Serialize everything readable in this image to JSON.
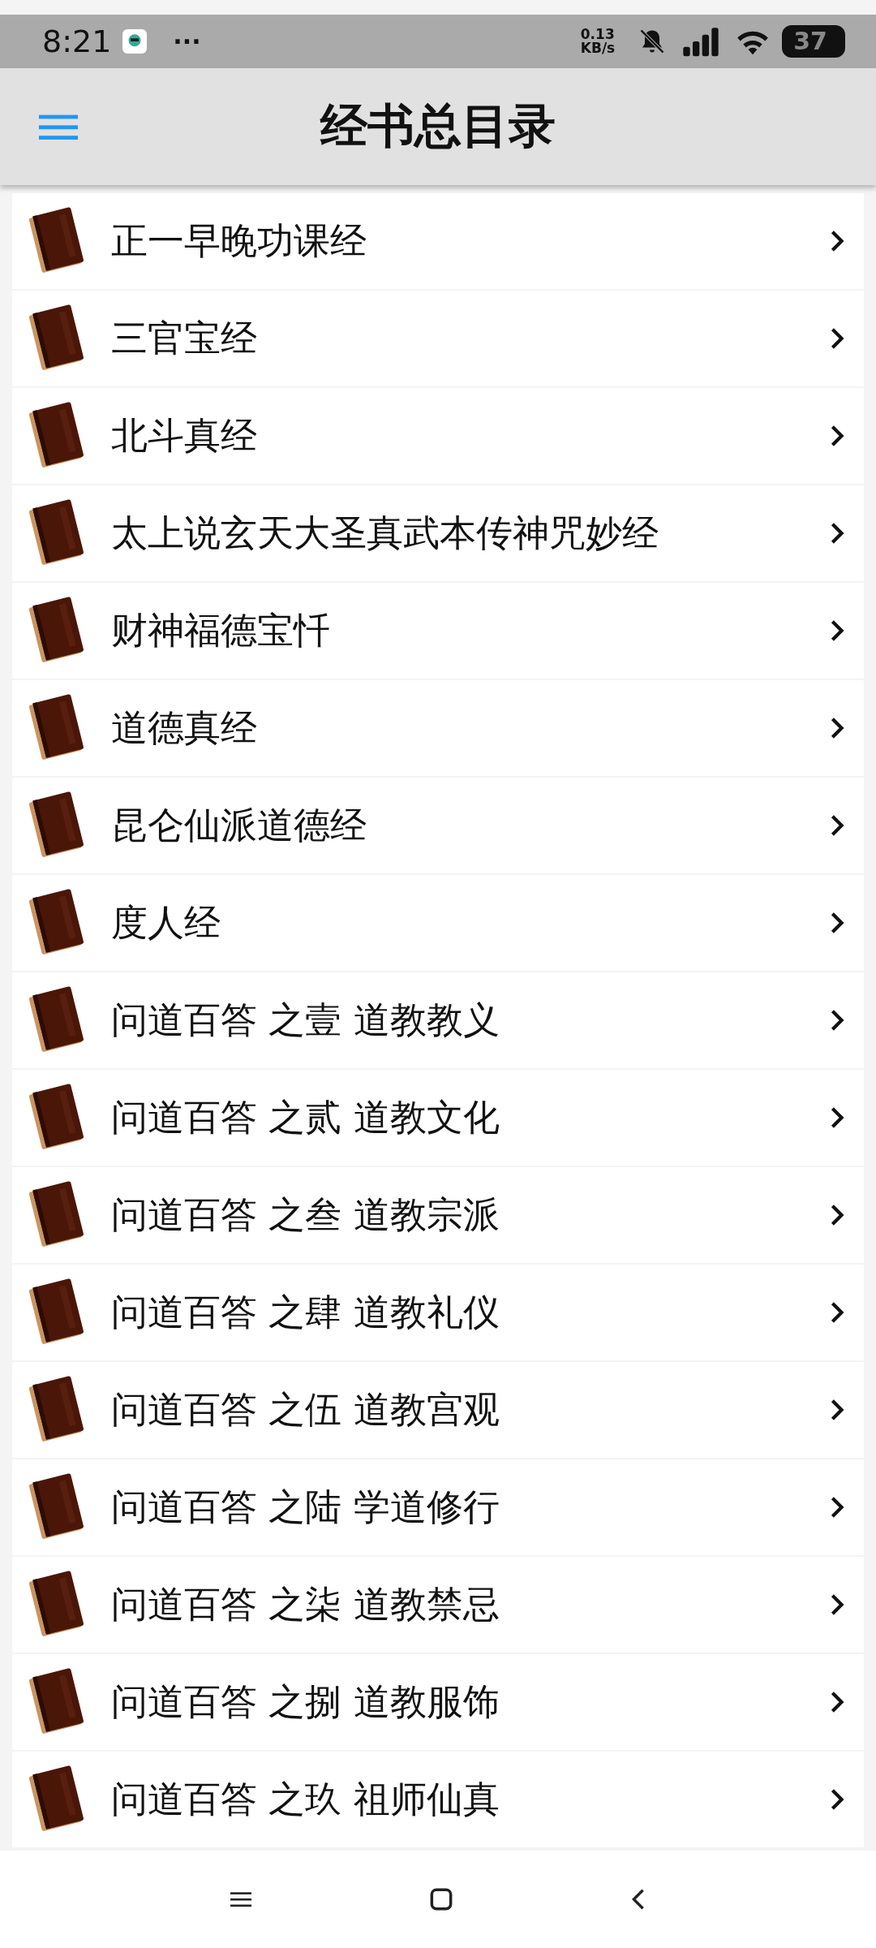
{
  "status_bar": {
    "time": "8:21",
    "more": "···",
    "speed_value": "0.13",
    "speed_unit": "KB/s",
    "battery": "37"
  },
  "app_bar": {
    "title": "经书总目录"
  },
  "list": [
    {
      "title": "正一早晚功课经"
    },
    {
      "title": "三官宝经"
    },
    {
      "title": "北斗真经"
    },
    {
      "title": "太上说玄天大圣真武本传神咒妙经"
    },
    {
      "title": "财神福德宝忏"
    },
    {
      "title": "道德真经"
    },
    {
      "title": "昆仑仙派道德经"
    },
    {
      "title": "度人经"
    },
    {
      "title": "问道百答 之壹 道教教义"
    },
    {
      "title": "问道百答 之贰 道教文化"
    },
    {
      "title": "问道百答 之叁 道教宗派"
    },
    {
      "title": "问道百答 之肆 道教礼仪"
    },
    {
      "title": "问道百答 之伍 道教宫观"
    },
    {
      "title": "问道百答 之陆 学道修行"
    },
    {
      "title": "问道百答 之柒 道教禁忌"
    },
    {
      "title": "问道百答 之捌 道教服饰"
    },
    {
      "title": "问道百答 之玖 祖师仙真"
    }
  ]
}
